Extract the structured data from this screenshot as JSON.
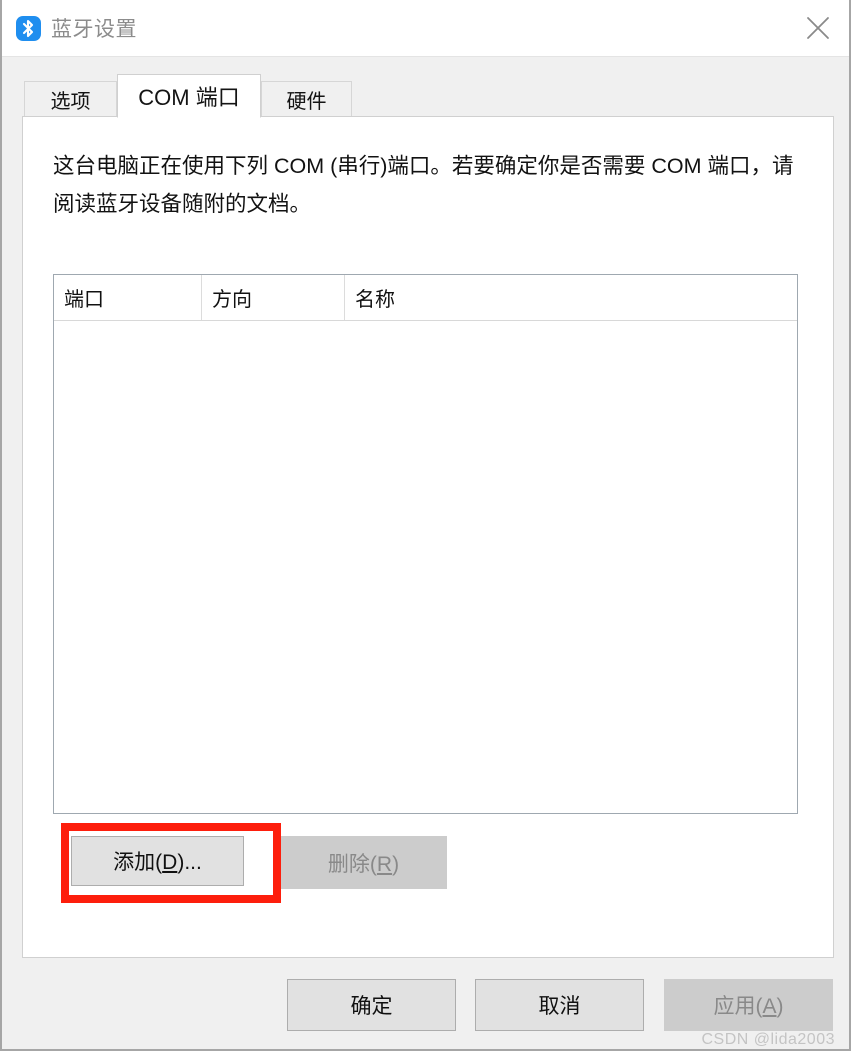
{
  "window": {
    "title": "蓝牙设置",
    "icon": "bluetooth-icon",
    "close_label": "✕",
    "background_color": "#f0f0f0",
    "accent_color": "#1f8eef"
  },
  "tabs": [
    {
      "label": "选项",
      "active": false
    },
    {
      "label": "COM 端口",
      "active": true
    },
    {
      "label": "硬件",
      "active": false
    }
  ],
  "main": {
    "description": "这台电脑正在使用下列 COM (串行)端口。若要确定你是否需要 COM 端口，请阅读蓝牙设备随附的文档。",
    "port_list": {
      "columns": [
        "端口",
        "方向",
        "名称"
      ],
      "rows": []
    },
    "add_button": {
      "label": "添加(D)...",
      "enabled": true,
      "highlight_color": "#fd1e0c"
    },
    "delete_button": {
      "label": "删除(R)",
      "enabled": false
    }
  },
  "footer": {
    "ok_label": "确定",
    "cancel_label": "取消",
    "apply_label": "应用(A)",
    "apply_enabled": false
  },
  "watermark": "CSDN @lida2003"
}
